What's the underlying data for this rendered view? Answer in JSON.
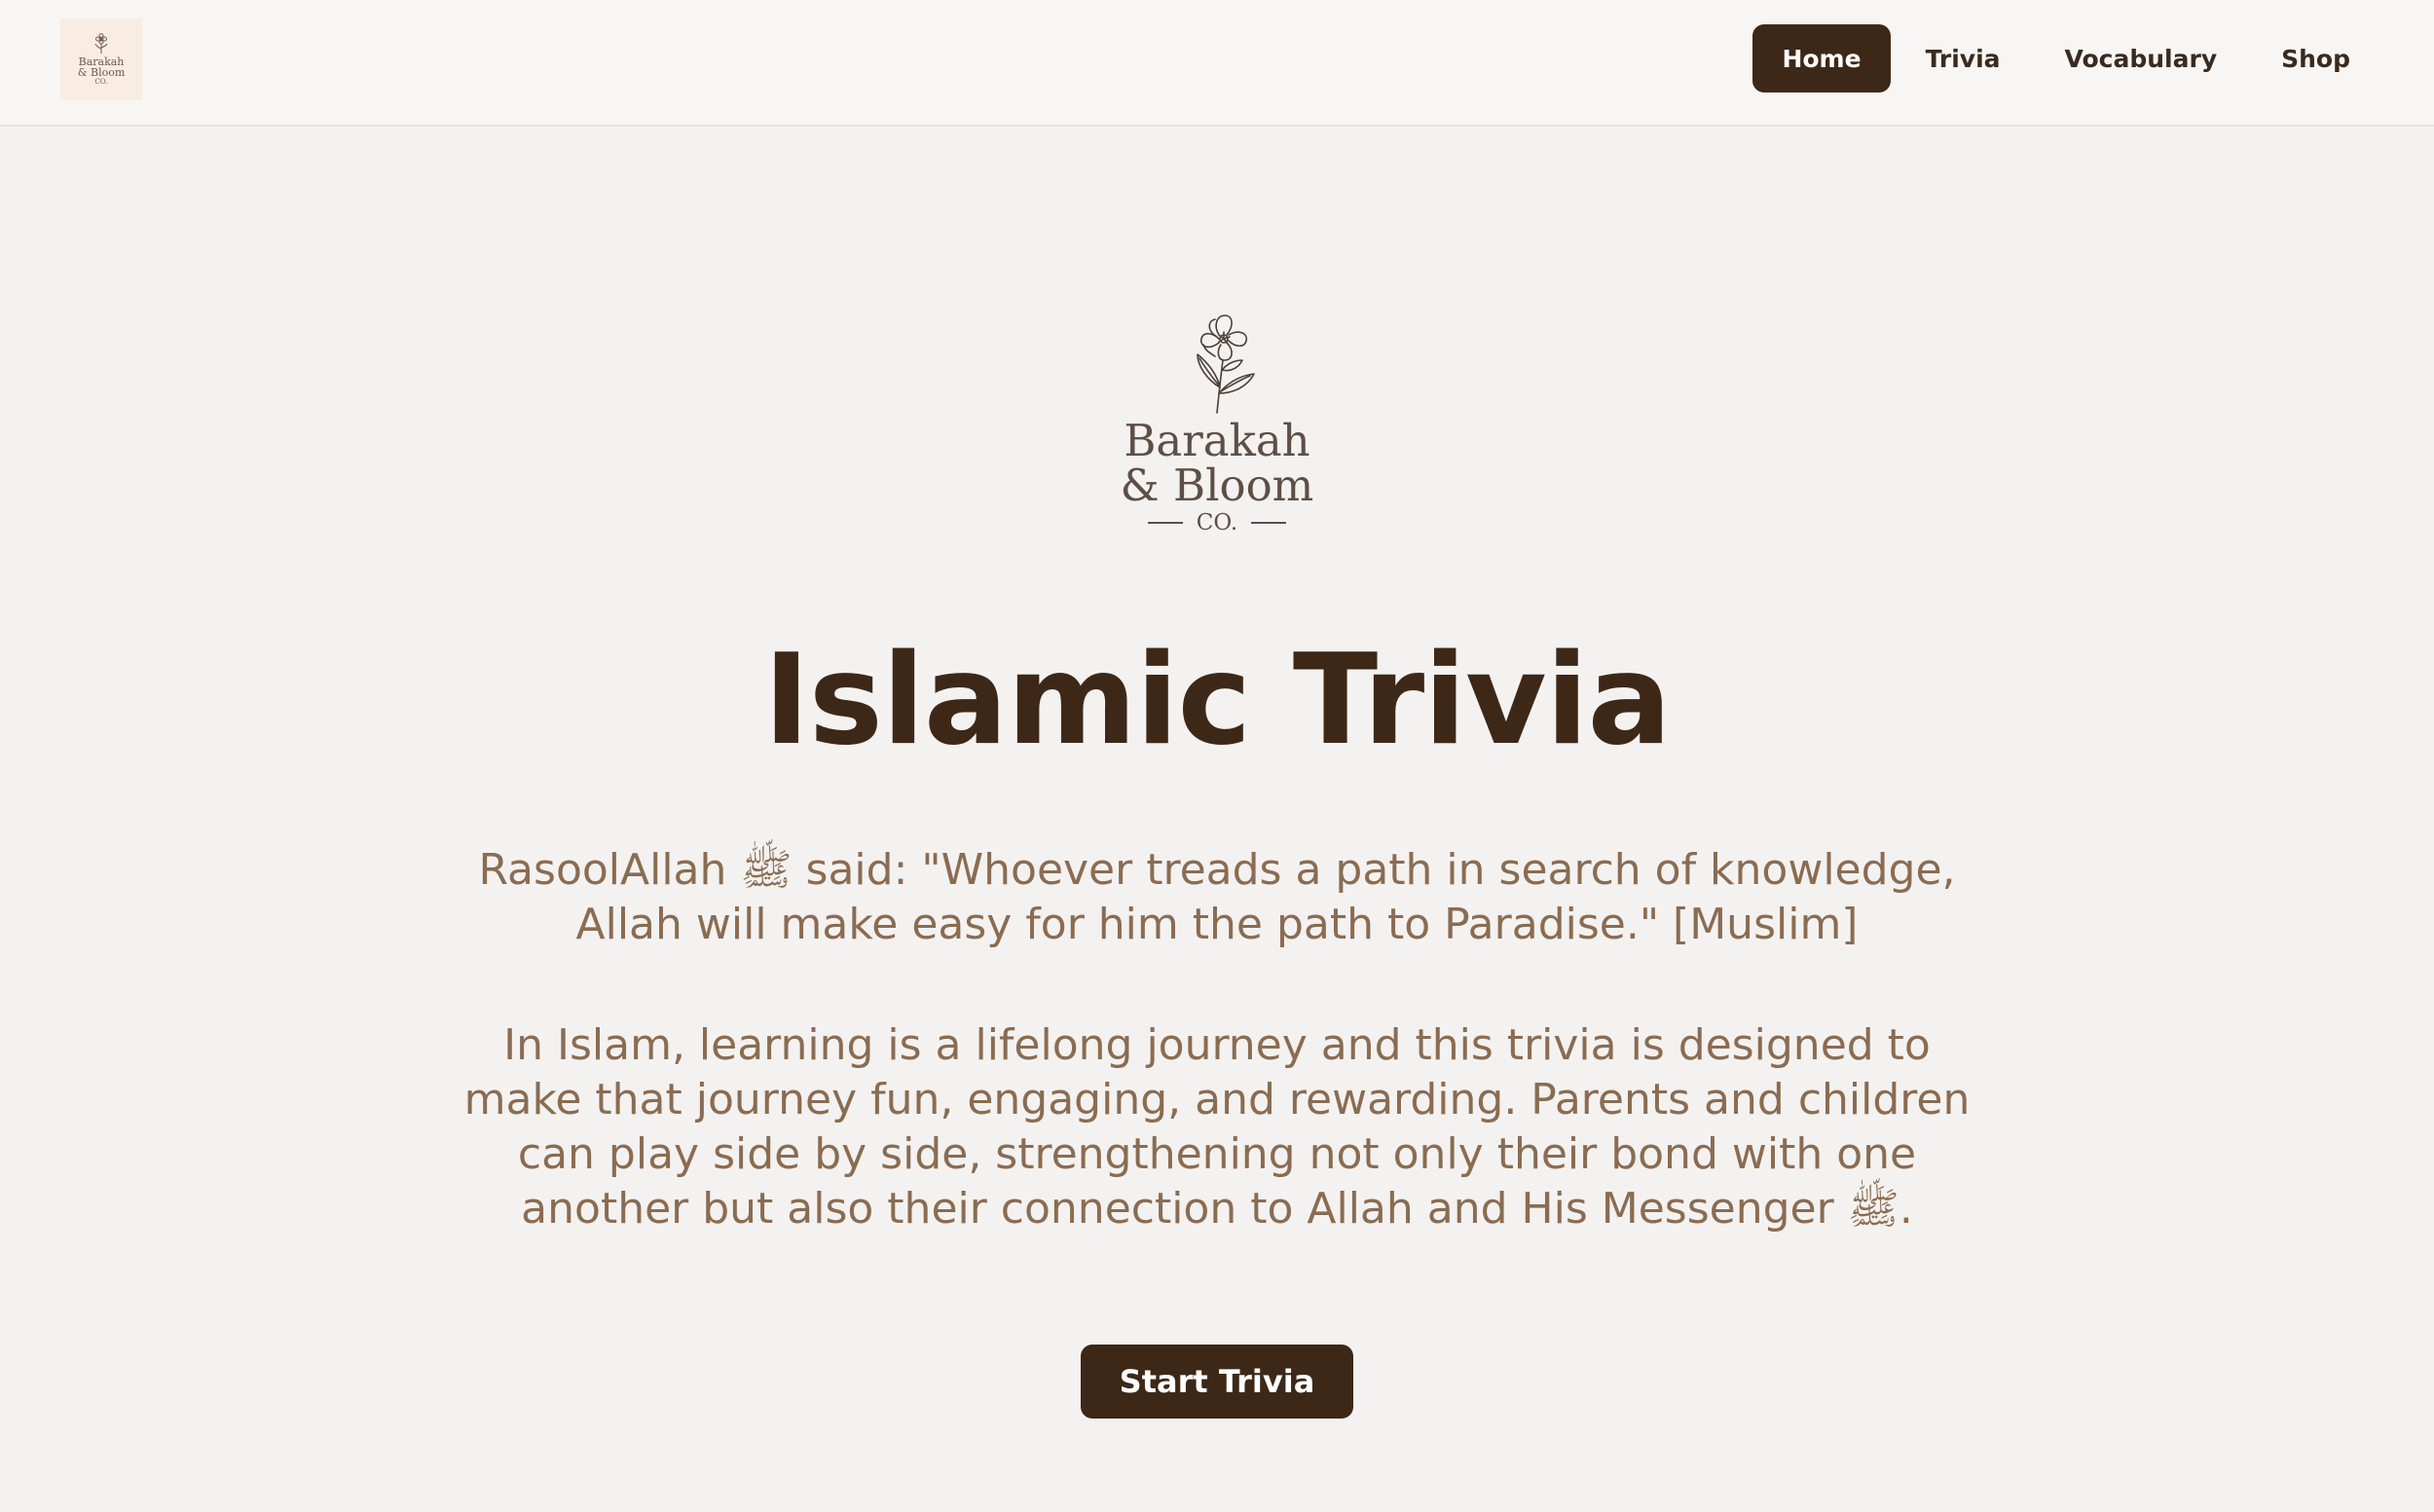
{
  "nav": {
    "logo": {
      "line1": "Barakah",
      "line2": "& Bloom",
      "line3": "CO."
    },
    "items": [
      {
        "label": "Home",
        "active": true
      },
      {
        "label": "Trivia",
        "active": false
      },
      {
        "label": "Vocabulary",
        "active": false
      },
      {
        "label": "Shop",
        "active": false
      }
    ]
  },
  "hero": {
    "logo": {
      "line1": "Barakah",
      "line2": "& Bloom",
      "line3": "CO."
    },
    "title": "Islamic Trivia",
    "quote": "RasoolAllah ﷺ said: \"Whoever treads a path in search of knowledge, Allah will make easy for him the path to Paradise.\" [Muslim]",
    "description": "In Islam, learning is a lifelong journey and this trivia is designed to make that journey fun, engaging, and rewarding. Parents and children can play side by side, strengthening not only their bond with one another but also their connection to Allah and His Messenger ﷺ.",
    "cta_label": "Start Trivia"
  },
  "colors": {
    "brand_dark": "#3d2818",
    "text_muted": "#8a6c52",
    "background": "#f4f2f0",
    "logo_tile": "#f9ece1"
  },
  "icons": {
    "brand_mark": "flower-icon"
  }
}
